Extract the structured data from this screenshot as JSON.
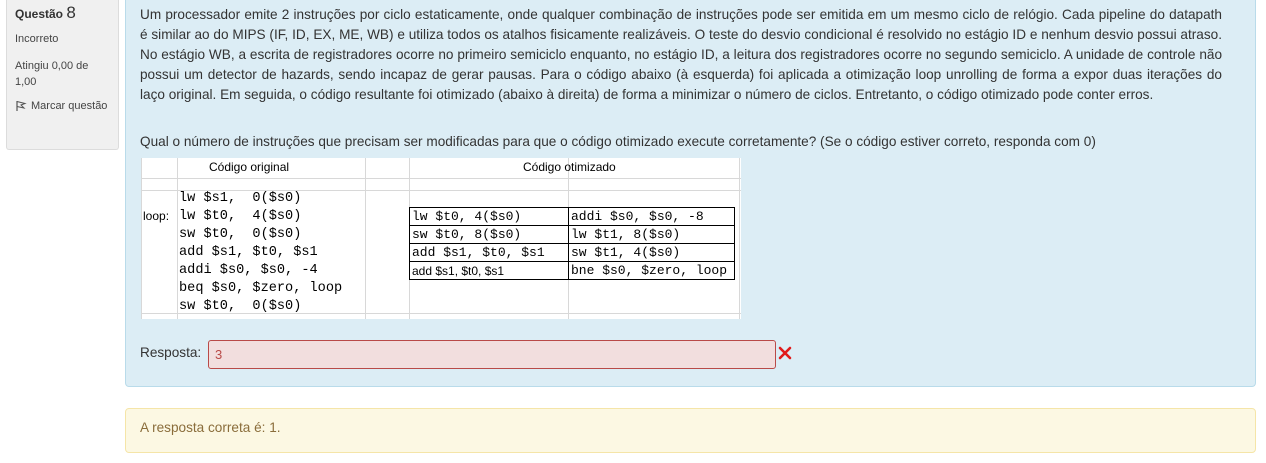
{
  "info": {
    "question_word": "Questão",
    "question_number": "8",
    "state": "Incorreto",
    "grade": "Atingiu 0,00 de 1,00",
    "flag_label": "Marcar questão"
  },
  "question": {
    "text": "Um processador emite 2 instruções por ciclo estaticamente, onde qualquer combinação de instruções pode ser emitida em um mesmo ciclo de relógio. Cada pipeline do datapath é similar ao do MIPS (IF, ID, EX, ME, WB) e utiliza todos os atalhos fisicamente realizáveis. O teste do desvio condicional é resolvido no estágio ID e nenhum desvio possui atraso. No estágio WB, a escrita de registradores ocorre no primeiro semiciclo enquanto, no estágio ID, a leitura dos registradores ocorre no segundo semiciclo. A unidade de controle não possui um detector de hazards, sendo incapaz de gerar pausas. Para o código abaixo (à esquerda) foi aplicada a otimização loop unrolling de forma a expor duas iterações do laço original. Em seguida, o código resultante foi otimizado (abaixo à direita) de forma a minimizar o número de ciclos. Entretanto, o código otimizado pode conter erros.",
    "prompt": "Qual o número de instruções que precisam ser modificadas para que o código otimizado execute corretamente? (Se o código estiver correto, responda com 0)"
  },
  "table": {
    "header_original": "Código original",
    "header_optimized": "Código otimizado",
    "loop_label": "loop:",
    "original_code": [
      "lw $s1,  0($s0)",
      "lw $t0,  4($s0)",
      "sw $t0,  0($s0)",
      "add $s1, $t0, $s1",
      "addi $s0, $s0, -4",
      "beq $s0, $zero, loop",
      "sw $t0,  0($s0)"
    ],
    "optimized_rows": [
      [
        "lw $t0, 4($s0)",
        "addi $s0, $s0, -8"
      ],
      [
        "sw $t0, 8($s0)",
        "lw $t1, 8($s0)"
      ],
      [
        "add $s1, $t0, $s1",
        "sw $t1, 4($s0)"
      ],
      [
        "add $s1, $t0, $s1",
        "bne $s0, $zero, loop"
      ]
    ]
  },
  "answer": {
    "label": "Resposta:",
    "value": "3"
  },
  "feedback": {
    "text": "A resposta correta é: 1."
  },
  "colors": {
    "incorrect": "#b94a48",
    "content_bg": "#dcedf5",
    "feedback_bg": "#fcf8e3"
  }
}
